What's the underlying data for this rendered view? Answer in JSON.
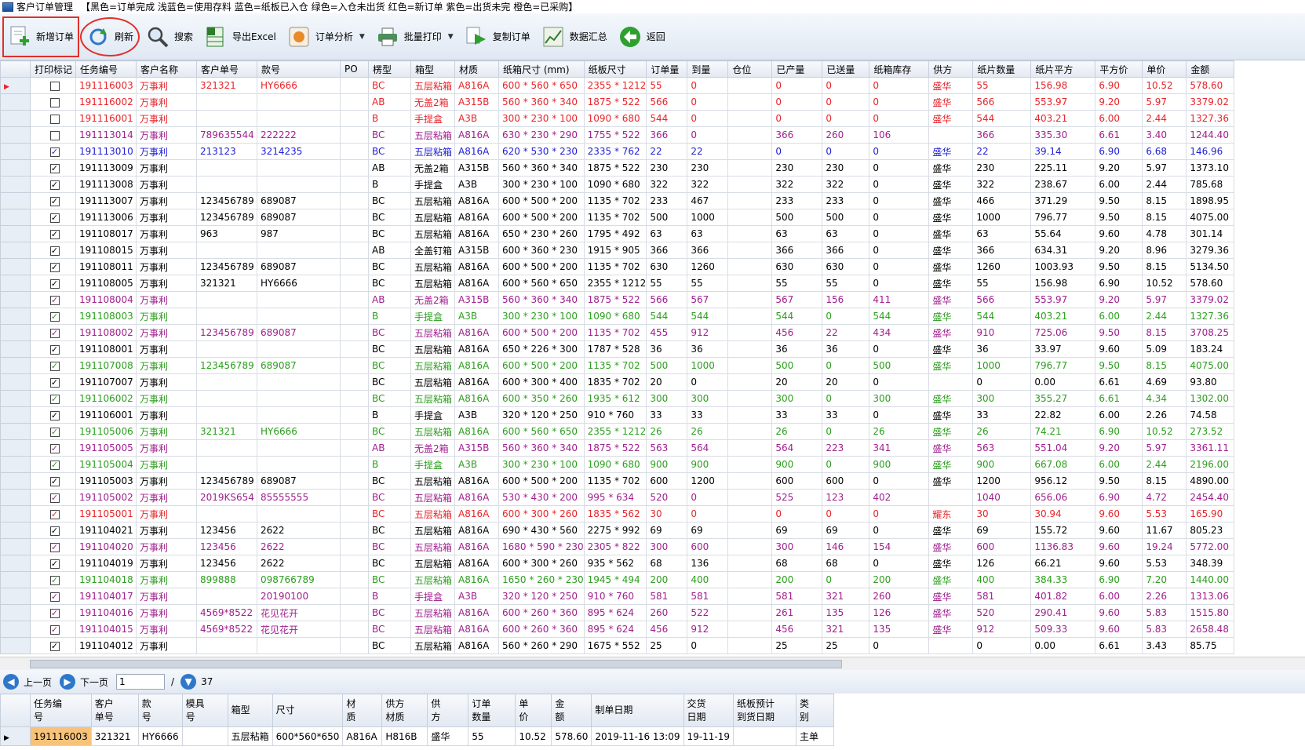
{
  "window": {
    "title": "客户订单管理",
    "legend": "【黑色=订单完成 浅蓝色=使用存料 蓝色=纸板已入仓 绿色=入仓未出货 红色=新订单 紫色=出货未完 橙色=已采购】"
  },
  "toolbar": {
    "new_order": "新增订单",
    "refresh": "刷新",
    "search": "搜索",
    "export": "导出Excel",
    "analysis": "订单分析",
    "batch_print": "批量打印",
    "copy_order": "复制订单",
    "summary": "数据汇总",
    "back": "返回"
  },
  "colors": {
    "red": "#e8252a",
    "blue": "#1f1fd6",
    "green": "#2c9e1e",
    "purple": "#a0208e",
    "black": "#000000",
    "highlight": "#e0302a",
    "selection": "#f7c37a"
  },
  "columns": [
    "打印标记",
    "任务编号",
    "客户名称",
    "客户单号",
    "款号",
    "PO",
    "楞型",
    "箱型",
    "材质",
    "纸箱尺寸 (mm)",
    "纸板尺寸",
    "订单量",
    "到量",
    "仓位",
    "已产量",
    "已送量",
    "纸箱库存",
    "供方",
    "纸片数量",
    "纸片平方",
    "平方价",
    "单价",
    "金额"
  ],
  "rows": [
    {
      "c": "red",
      "chk": false,
      "v": [
        "191116003",
        "万事利",
        "321321",
        "HY6666",
        "",
        "BC",
        "五层粘箱",
        "A816A",
        "600 * 560 * 650",
        "2355 * 1212",
        "55",
        "0",
        "",
        "0",
        "0",
        "0",
        "盛华",
        "55",
        "156.98",
        "6.90",
        "10.52",
        "578.60"
      ]
    },
    {
      "c": "red",
      "chk": false,
      "v": [
        "191116002",
        "万事利",
        "",
        "",
        "",
        "AB",
        "无盖2箱",
        "A315B",
        "560 * 360 * 340",
        "1875 * 522",
        "566",
        "0",
        "",
        "0",
        "0",
        "0",
        "盛华",
        "566",
        "553.97",
        "9.20",
        "5.97",
        "3379.02"
      ]
    },
    {
      "c": "red",
      "chk": false,
      "v": [
        "191116001",
        "万事利",
        "",
        "",
        "",
        "B",
        "手提盒",
        "A3B",
        "300 * 230 * 100",
        "1090 * 680",
        "544",
        "0",
        "",
        "0",
        "0",
        "0",
        "盛华",
        "544",
        "403.21",
        "6.00",
        "2.44",
        "1327.36"
      ]
    },
    {
      "c": "purple",
      "chk": false,
      "v": [
        "191113014",
        "万事利",
        "789635544",
        "222222",
        "",
        "BC",
        "五层粘箱",
        "A816A",
        "630 * 230 * 290",
        "1755 * 522",
        "366",
        "0",
        "",
        "366",
        "260",
        "106",
        "",
        "366",
        "335.30",
        "6.61",
        "3.40",
        "1244.40"
      ]
    },
    {
      "c": "blue",
      "chk": true,
      "v": [
        "191113010",
        "万事利",
        "213123",
        "3214235",
        "",
        "BC",
        "五层粘箱",
        "A816A",
        "620 * 530 * 230",
        "2335 * 762",
        "22",
        "22",
        "",
        "0",
        "0",
        "0",
        "盛华",
        "22",
        "39.14",
        "6.90",
        "6.68",
        "146.96"
      ]
    },
    {
      "c": "black",
      "chk": true,
      "v": [
        "191113009",
        "万事利",
        "",
        "",
        "",
        "AB",
        "无盖2箱",
        "A315B",
        "560 * 360 * 340",
        "1875 * 522",
        "230",
        "230",
        "",
        "230",
        "230",
        "0",
        "盛华",
        "230",
        "225.11",
        "9.20",
        "5.97",
        "1373.10"
      ]
    },
    {
      "c": "black",
      "chk": true,
      "v": [
        "191113008",
        "万事利",
        "",
        "",
        "",
        "B",
        "手提盒",
        "A3B",
        "300 * 230 * 100",
        "1090 * 680",
        "322",
        "322",
        "",
        "322",
        "322",
        "0",
        "盛华",
        "322",
        "238.67",
        "6.00",
        "2.44",
        "785.68"
      ]
    },
    {
      "c": "black",
      "chk": true,
      "v": [
        "191113007",
        "万事利",
        "123456789",
        "689087",
        "",
        "BC",
        "五层粘箱",
        "A816A",
        "600 * 500 * 200",
        "1135 * 702",
        "233",
        "467",
        "",
        "233",
        "233",
        "0",
        "盛华",
        "466",
        "371.29",
        "9.50",
        "8.15",
        "1898.95"
      ]
    },
    {
      "c": "black",
      "chk": true,
      "v": [
        "191113006",
        "万事利",
        "123456789",
        "689087",
        "",
        "BC",
        "五层粘箱",
        "A816A",
        "600 * 500 * 200",
        "1135 * 702",
        "500",
        "1000",
        "",
        "500",
        "500",
        "0",
        "盛华",
        "1000",
        "796.77",
        "9.50",
        "8.15",
        "4075.00"
      ]
    },
    {
      "c": "black",
      "chk": true,
      "v": [
        "191108017",
        "万事利",
        "963",
        "987",
        "",
        "BC",
        "五层粘箱",
        "A816A",
        "650 * 230 * 260",
        "1795 * 492",
        "63",
        "63",
        "",
        "63",
        "63",
        "0",
        "盛华",
        "63",
        "55.64",
        "9.60",
        "4.78",
        "301.14"
      ]
    },
    {
      "c": "black",
      "chk": true,
      "v": [
        "191108015",
        "万事利",
        "",
        "",
        "",
        "AB",
        "全盖钉箱",
        "A315B",
        "600 * 360 * 230",
        "1915 * 905",
        "366",
        "366",
        "",
        "366",
        "366",
        "0",
        "盛华",
        "366",
        "634.31",
        "9.20",
        "8.96",
        "3279.36"
      ]
    },
    {
      "c": "black",
      "chk": true,
      "v": [
        "191108011",
        "万事利",
        "123456789",
        "689087",
        "",
        "BC",
        "五层粘箱",
        "A816A",
        "600 * 500 * 200",
        "1135 * 702",
        "630",
        "1260",
        "",
        "630",
        "630",
        "0",
        "盛华",
        "1260",
        "1003.93",
        "9.50",
        "8.15",
        "5134.50"
      ]
    },
    {
      "c": "black",
      "chk": true,
      "v": [
        "191108005",
        "万事利",
        "321321",
        "HY6666",
        "",
        "BC",
        "五层粘箱",
        "A816A",
        "600 * 560 * 650",
        "2355 * 1212",
        "55",
        "55",
        "",
        "55",
        "55",
        "0",
        "盛华",
        "55",
        "156.98",
        "6.90",
        "10.52",
        "578.60"
      ]
    },
    {
      "c": "purple",
      "chk": true,
      "v": [
        "191108004",
        "万事利",
        "",
        "",
        "",
        "AB",
        "无盖2箱",
        "A315B",
        "560 * 360 * 340",
        "1875 * 522",
        "566",
        "567",
        "",
        "567",
        "156",
        "411",
        "盛华",
        "566",
        "553.97",
        "9.20",
        "5.97",
        "3379.02"
      ]
    },
    {
      "c": "green",
      "chk": true,
      "v": [
        "191108003",
        "万事利",
        "",
        "",
        "",
        "B",
        "手提盒",
        "A3B",
        "300 * 230 * 100",
        "1090 * 680",
        "544",
        "544",
        "",
        "544",
        "0",
        "544",
        "盛华",
        "544",
        "403.21",
        "6.00",
        "2.44",
        "1327.36"
      ]
    },
    {
      "c": "purple",
      "chk": true,
      "v": [
        "191108002",
        "万事利",
        "123456789",
        "689087",
        "",
        "BC",
        "五层粘箱",
        "A816A",
        "600 * 500 * 200",
        "1135 * 702",
        "455",
        "912",
        "",
        "456",
        "22",
        "434",
        "盛华",
        "910",
        "725.06",
        "9.50",
        "8.15",
        "3708.25"
      ]
    },
    {
      "c": "black",
      "chk": true,
      "v": [
        "191108001",
        "万事利",
        "",
        "",
        "",
        "BC",
        "五层粘箱",
        "A816A",
        "650 * 226 * 300",
        "1787 * 528",
        "36",
        "36",
        "",
        "36",
        "36",
        "0",
        "盛华",
        "36",
        "33.97",
        "9.60",
        "5.09",
        "183.24"
      ]
    },
    {
      "c": "green",
      "chk": true,
      "v": [
        "191107008",
        "万事利",
        "123456789",
        "689087",
        "",
        "BC",
        "五层粘箱",
        "A816A",
        "600 * 500 * 200",
        "1135 * 702",
        "500",
        "1000",
        "",
        "500",
        "0",
        "500",
        "盛华",
        "1000",
        "796.77",
        "9.50",
        "8.15",
        "4075.00"
      ]
    },
    {
      "c": "black",
      "chk": true,
      "v": [
        "191107007",
        "万事利",
        "",
        "",
        "",
        "BC",
        "五层粘箱",
        "A816A",
        "600 * 300 * 400",
        "1835 * 702",
        "20",
        "0",
        "",
        "20",
        "20",
        "0",
        "",
        "0",
        "0.00",
        "6.61",
        "4.69",
        "93.80"
      ]
    },
    {
      "c": "green",
      "chk": true,
      "v": [
        "191106002",
        "万事利",
        "",
        "",
        "",
        "BC",
        "五层粘箱",
        "A816A",
        "600 * 350 * 260",
        "1935 * 612",
        "300",
        "300",
        "",
        "300",
        "0",
        "300",
        "盛华",
        "300",
        "355.27",
        "6.61",
        "4.34",
        "1302.00"
      ]
    },
    {
      "c": "black",
      "chk": true,
      "v": [
        "191106001",
        "万事利",
        "",
        "",
        "",
        "B",
        "手提盒",
        "A3B",
        "320 * 120 * 250",
        "910 * 760",
        "33",
        "33",
        "",
        "33",
        "33",
        "0",
        "盛华",
        "33",
        "22.82",
        "6.00",
        "2.26",
        "74.58"
      ]
    },
    {
      "c": "green",
      "chk": true,
      "v": [
        "191105006",
        "万事利",
        "321321",
        "HY6666",
        "",
        "BC",
        "五层粘箱",
        "A816A",
        "600 * 560 * 650",
        "2355 * 1212",
        "26",
        "26",
        "",
        "26",
        "0",
        "26",
        "盛华",
        "26",
        "74.21",
        "6.90",
        "10.52",
        "273.52"
      ]
    },
    {
      "c": "purple",
      "chk": true,
      "v": [
        "191105005",
        "万事利",
        "",
        "",
        "",
        "AB",
        "无盖2箱",
        "A315B",
        "560 * 360 * 340",
        "1875 * 522",
        "563",
        "564",
        "",
        "564",
        "223",
        "341",
        "盛华",
        "563",
        "551.04",
        "9.20",
        "5.97",
        "3361.11"
      ]
    },
    {
      "c": "green",
      "chk": true,
      "v": [
        "191105004",
        "万事利",
        "",
        "",
        "",
        "B",
        "手提盒",
        "A3B",
        "300 * 230 * 100",
        "1090 * 680",
        "900",
        "900",
        "",
        "900",
        "0",
        "900",
        "盛华",
        "900",
        "667.08",
        "6.00",
        "2.44",
        "2196.00"
      ]
    },
    {
      "c": "black",
      "chk": true,
      "v": [
        "191105003",
        "万事利",
        "123456789",
        "689087",
        "",
        "BC",
        "五层粘箱",
        "A816A",
        "600 * 500 * 200",
        "1135 * 702",
        "600",
        "1200",
        "",
        "600",
        "600",
        "0",
        "盛华",
        "1200",
        "956.12",
        "9.50",
        "8.15",
        "4890.00"
      ]
    },
    {
      "c": "purple",
      "chk": true,
      "v": [
        "191105002",
        "万事利",
        "2019KS654",
        "85555555",
        "",
        "BC",
        "五层粘箱",
        "A816A",
        "530 * 430 * 200",
        "995 * 634",
        "520",
        "0",
        "",
        "525",
        "123",
        "402",
        "",
        "1040",
        "656.06",
        "6.90",
        "4.72",
        "2454.40"
      ]
    },
    {
      "c": "red",
      "chk": true,
      "v": [
        "191105001",
        "万事利",
        "",
        "",
        "",
        "BC",
        "五层粘箱",
        "A816A",
        "600 * 300 * 260",
        "1835 * 562",
        "30",
        "0",
        "",
        "0",
        "0",
        "0",
        "耀东",
        "30",
        "30.94",
        "9.60",
        "5.53",
        "165.90"
      ]
    },
    {
      "c": "black",
      "chk": true,
      "v": [
        "191104021",
        "万事利",
        "123456",
        "2622",
        "",
        "BC",
        "五层粘箱",
        "A816A",
        "690 * 430 * 560",
        "2275 * 992",
        "69",
        "69",
        "",
        "69",
        "69",
        "0",
        "盛华",
        "69",
        "155.72",
        "9.60",
        "11.67",
        "805.23"
      ]
    },
    {
      "c": "purple",
      "chk": true,
      "v": [
        "191104020",
        "万事利",
        "123456",
        "2622",
        "",
        "BC",
        "五层粘箱",
        "A816A",
        "1680 * 590 * 230",
        "2305 * 822",
        "300",
        "600",
        "",
        "300",
        "146",
        "154",
        "盛华",
        "600",
        "1136.83",
        "9.60",
        "19.24",
        "5772.00"
      ]
    },
    {
      "c": "black",
      "chk": true,
      "v": [
        "191104019",
        "万事利",
        "123456",
        "2622",
        "",
        "BC",
        "五层粘箱",
        "A816A",
        "600 * 300 * 260",
        "935 * 562",
        "68",
        "136",
        "",
        "68",
        "68",
        "0",
        "盛华",
        "126",
        "66.21",
        "9.60",
        "5.53",
        "348.39"
      ]
    },
    {
      "c": "green",
      "chk": true,
      "v": [
        "191104018",
        "万事利",
        "899888",
        "098766789",
        "",
        "BC",
        "五层粘箱",
        "A816A",
        "1650 * 260 * 230",
        "1945 * 494",
        "200",
        "400",
        "",
        "200",
        "0",
        "200",
        "盛华",
        "400",
        "384.33",
        "6.90",
        "7.20",
        "1440.00"
      ]
    },
    {
      "c": "purple",
      "chk": true,
      "v": [
        "191104017",
        "万事利",
        "",
        "20190100",
        "",
        "B",
        "手提盒",
        "A3B",
        "320 * 120 * 250",
        "910 * 760",
        "581",
        "581",
        "",
        "581",
        "321",
        "260",
        "盛华",
        "581",
        "401.82",
        "6.00",
        "2.26",
        "1313.06"
      ]
    },
    {
      "c": "purple",
      "chk": true,
      "v": [
        "191104016",
        "万事利",
        "4569*8522",
        "花见花开",
        "",
        "BC",
        "五层粘箱",
        "A816A",
        "600 * 260 * 360",
        "895 * 624",
        "260",
        "522",
        "",
        "261",
        "135",
        "126",
        "盛华",
        "520",
        "290.41",
        "9.60",
        "5.83",
        "1515.80"
      ]
    },
    {
      "c": "purple",
      "chk": true,
      "v": [
        "191104015",
        "万事利",
        "4569*8522",
        "花见花开",
        "",
        "BC",
        "五层粘箱",
        "A816A",
        "600 * 260 * 360",
        "895 * 624",
        "456",
        "912",
        "",
        "456",
        "321",
        "135",
        "盛华",
        "912",
        "509.33",
        "9.60",
        "5.83",
        "2658.48"
      ]
    },
    {
      "c": "black",
      "chk": true,
      "v": [
        "191104012",
        "万事利",
        "",
        "",
        "",
        "BC",
        "五层粘箱",
        "A816A",
        "560 * 260 * 290",
        "1675 * 552",
        "25",
        "0",
        "",
        "25",
        "25",
        "0",
        "",
        "0",
        "0.00",
        "6.61",
        "3.43",
        "85.75"
      ]
    }
  ],
  "pager": {
    "prev": "上一页",
    "next": "下一页",
    "page": "1",
    "sep": "/",
    "total": "37"
  },
  "detail": {
    "columns": [
      "任务编\n号",
      "客户\n单号",
      "款\n号",
      "模具\n号",
      "箱型",
      "尺寸",
      "材\n质",
      "供方\n材质",
      "供\n方",
      "订单\n数量",
      "单\n价",
      "金\n额",
      "制单日期",
      "交货\n日期",
      "纸板预计\n到货日期",
      "类\n别"
    ],
    "row": [
      "191116003",
      "321321",
      "HY6666",
      "",
      "五层粘箱",
      "600*560*650",
      "A816A",
      "H816B",
      "盛华",
      "55",
      "10.52",
      "578.60",
      "2019-11-16  13:09",
      "19-11-19",
      "",
      "主单"
    ]
  }
}
